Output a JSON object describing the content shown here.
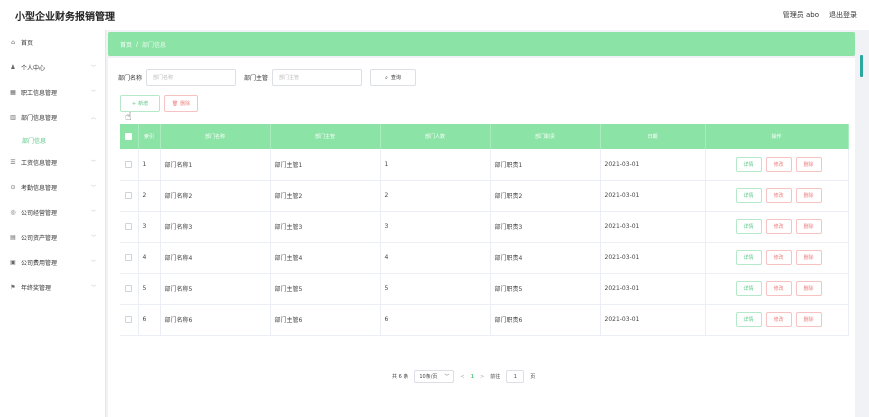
{
  "header": {
    "title": "小型企业财务报销管理",
    "user": "管理员 abo",
    "logout": "退出登录"
  },
  "sidebar": {
    "items": [
      {
        "icon": "⌂",
        "label": "首页",
        "chev": ""
      },
      {
        "icon": "♟",
        "label": "个人中心",
        "chev": "﹀"
      },
      {
        "icon": "▦",
        "label": "职工信息管理",
        "chev": "﹀"
      },
      {
        "icon": "▥",
        "label": "部门信息管理",
        "chev": "︿"
      }
    ],
    "sub": "部门信息",
    "items2": [
      {
        "icon": "☰",
        "label": "工资信息管理",
        "chev": "﹀"
      },
      {
        "icon": "⊙",
        "label": "考勤信息管理",
        "chev": "﹀"
      },
      {
        "icon": "◎",
        "label": "公司经营管理",
        "chev": "﹀"
      },
      {
        "icon": "▤",
        "label": "公司资产管理",
        "chev": "﹀"
      },
      {
        "icon": "▣",
        "label": "公司费用管理",
        "chev": "﹀"
      },
      {
        "icon": "⚑",
        "label": "年终奖管理",
        "chev": "﹀"
      }
    ]
  },
  "breadcrumb": {
    "home": "首页",
    "sep": "/",
    "current": "部门信息"
  },
  "search": {
    "name_label": "部门名称",
    "name_placeholder": "部门名称",
    "head_label": "部门主管",
    "head_placeholder": "部门主管",
    "btn": "查询"
  },
  "actions": {
    "add": "新增",
    "delete": "删除"
  },
  "table": {
    "headers": [
      "索引",
      "部门名称",
      "部门主管",
      "部门人数",
      "部门职责",
      "日期",
      "操作"
    ],
    "rows": [
      [
        "1",
        "部门名称1",
        "部门主管1",
        "1",
        "部门职责1",
        "2021-03-01"
      ],
      [
        "2",
        "部门名称2",
        "部门主管2",
        "2",
        "部门职责2",
        "2021-03-01"
      ],
      [
        "3",
        "部门名称3",
        "部门主管3",
        "3",
        "部门职责3",
        "2021-03-01"
      ],
      [
        "4",
        "部门名称4",
        "部门主管4",
        "4",
        "部门职责4",
        "2021-03-01"
      ],
      [
        "5",
        "部门名称5",
        "部门主管5",
        "5",
        "部门职责5",
        "2021-03-01"
      ],
      [
        "6",
        "部门名称6",
        "部门主管6",
        "6",
        "部门职责6",
        "2021-03-01"
      ]
    ],
    "ops": {
      "detail": "详情",
      "edit": "修改",
      "delete": "删除"
    }
  },
  "pagination": {
    "total": "共 6 条",
    "size": "10条/页",
    "prev": "<",
    "current": "1",
    "next": ">",
    "goto": "前往",
    "page": "1",
    "unit": "页"
  }
}
